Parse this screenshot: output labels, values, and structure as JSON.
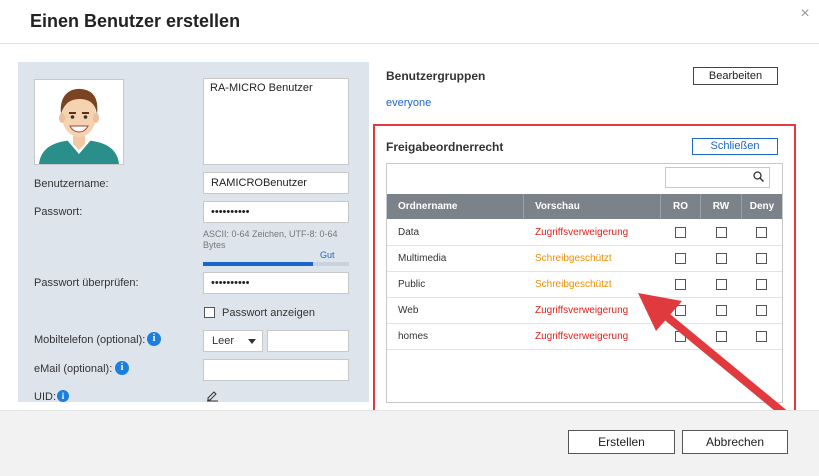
{
  "dialog": {
    "title": "Einen Benutzer erstellen",
    "close_glyph": "×"
  },
  "user": {
    "description": "RA-MICRO Benutzer",
    "username_label": "Benutzername:",
    "username_value": "RAMICROBenutzer",
    "password_label": "Passwort:",
    "password_value": "••••••••••",
    "password_hint": "ASCII: 0-64 Zeichen, UTF-8: 0-64 Bytes",
    "strength_label": "Gut",
    "strength_fraction": 0.75,
    "confirm_label": "Passwort überprüfen:",
    "confirm_value": "••••••••••",
    "show_password_label": "Passwort anzeigen",
    "show_password_checked": false,
    "mobile_label": "Mobiltelefon (optional):",
    "mobile_country": "Leer",
    "mobile_value": "",
    "email_label": "eMail (optional):",
    "email_value": "",
    "uid_label": "UID:",
    "info_glyph": "i"
  },
  "groups": {
    "heading": "Benutzergruppen",
    "edit_button": "Bearbeiten",
    "member_of": "everyone"
  },
  "shares": {
    "heading": "Freigabeordnerrecht",
    "close_button": "Schließen",
    "search_value": "",
    "columns": [
      "Ordnername",
      "Vorschau",
      "RO",
      "RW",
      "Deny"
    ],
    "rows": [
      {
        "name": "Data",
        "preview": "Zugriffsverweigerung",
        "status": "denied"
      },
      {
        "name": "Multimedia",
        "preview": "Schreibgeschützt",
        "status": "readonly"
      },
      {
        "name": "Public",
        "preview": "Schreibgeschützt",
        "status": "readonly"
      },
      {
        "name": "Web",
        "preview": "Zugriffsverweigerung",
        "status": "denied"
      },
      {
        "name": "homes",
        "preview": "Zugriffsverweigerung",
        "status": "denied"
      }
    ]
  },
  "footer": {
    "create_button": "Erstellen",
    "cancel_button": "Abbrechen"
  },
  "colors": {
    "accent": "#1b66c9",
    "denied": "#e0231e",
    "readonly": "#ef8f00",
    "highlight": "#e03a3e"
  }
}
